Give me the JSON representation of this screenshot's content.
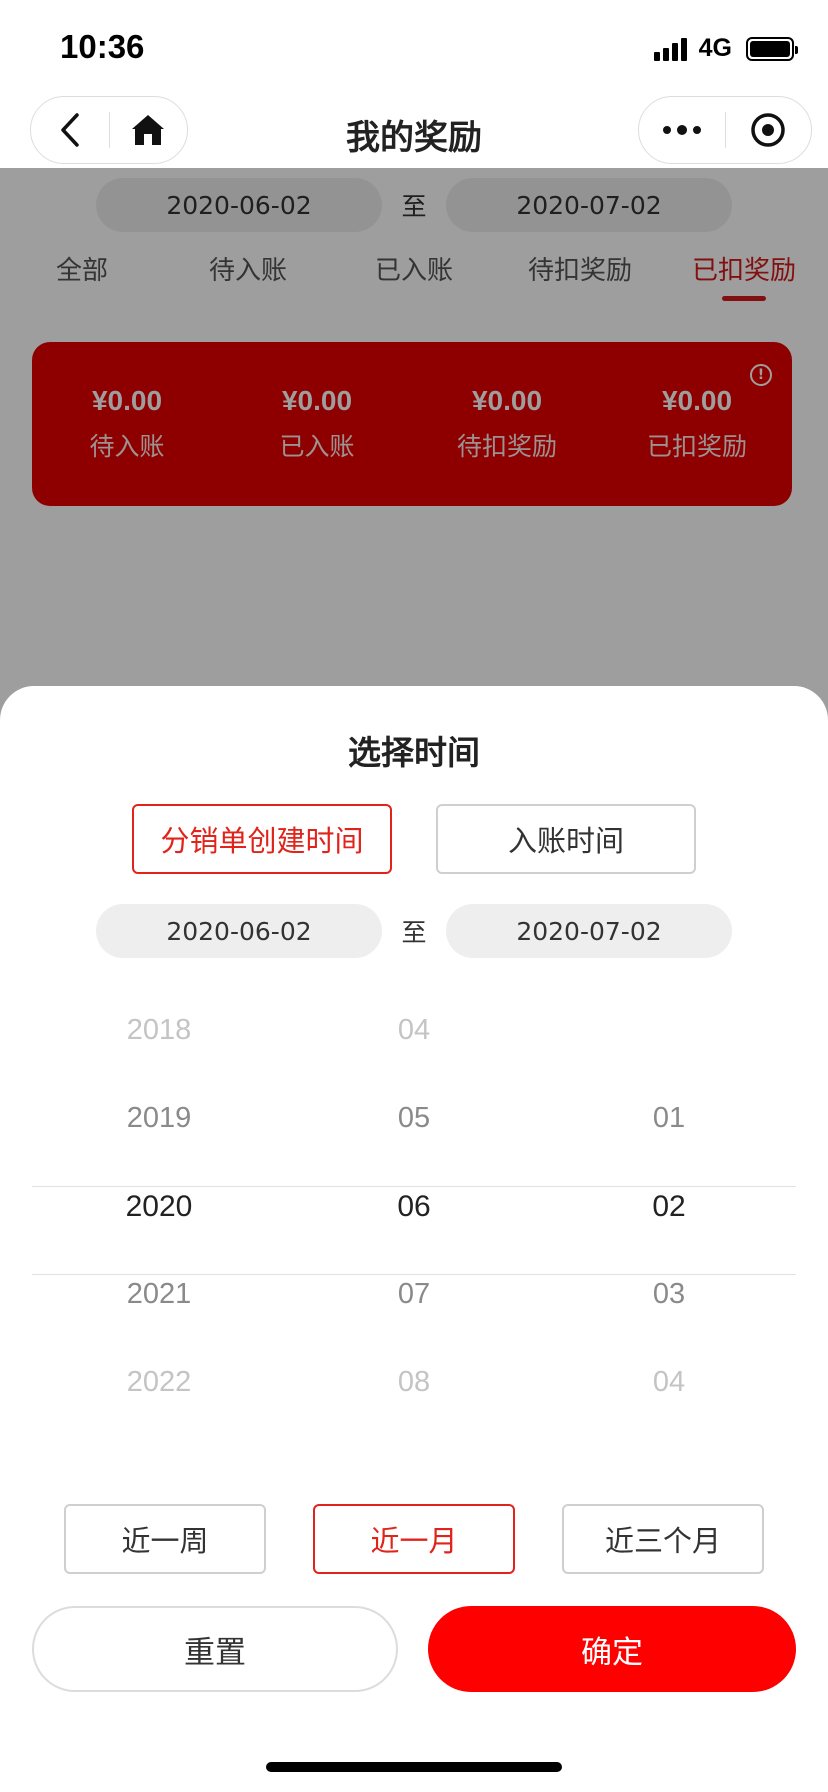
{
  "status_bar": {
    "time": "10:36",
    "network": "4G"
  },
  "nav": {
    "title": "我的奖励"
  },
  "page": {
    "date_range": {
      "start": "2020-06-02",
      "separator": "至",
      "end": "2020-07-02"
    },
    "tabs": [
      {
        "label": "全部",
        "active": false
      },
      {
        "label": "待入账",
        "active": false
      },
      {
        "label": "已入账",
        "active": false
      },
      {
        "label": "待扣奖励",
        "active": false
      },
      {
        "label": "已扣奖励",
        "active": true
      }
    ],
    "summary": [
      {
        "value": "¥0.00",
        "label": "待入账"
      },
      {
        "value": "¥0.00",
        "label": "已入账"
      },
      {
        "value": "¥0.00",
        "label": "待扣奖励"
      },
      {
        "value": "¥0.00",
        "label": "已扣奖励"
      }
    ],
    "info_icon": "!"
  },
  "sheet": {
    "title": "选择时间",
    "type_buttons": [
      {
        "label": "分销单创建时间",
        "active": true
      },
      {
        "label": "入账时间",
        "active": false
      }
    ],
    "date_range": {
      "start": "2020-06-02",
      "separator": "至",
      "end": "2020-07-02"
    },
    "picker": {
      "years": [
        "2018",
        "2019",
        "2020",
        "2021",
        "2022"
      ],
      "months": [
        "04",
        "05",
        "06",
        "07",
        "08"
      ],
      "days": [
        "",
        "01",
        "02",
        "03",
        "04"
      ],
      "selected": {
        "year": "2020",
        "month": "06",
        "day": "02"
      }
    },
    "quick_ranges": [
      {
        "label": "近一周",
        "active": false
      },
      {
        "label": "近一月",
        "active": true
      },
      {
        "label": "近三个月",
        "active": false
      }
    ],
    "reset_label": "重置",
    "confirm_label": "确定"
  },
  "colors": {
    "accent": "#e0231b",
    "confirm": "#ff0000",
    "summary_card": "#e60000",
    "overlay": "rgba(0,0,0,0.38)"
  },
  "icons": [
    "back-icon",
    "home-icon",
    "more-icon",
    "target-icon",
    "info-icon"
  ]
}
